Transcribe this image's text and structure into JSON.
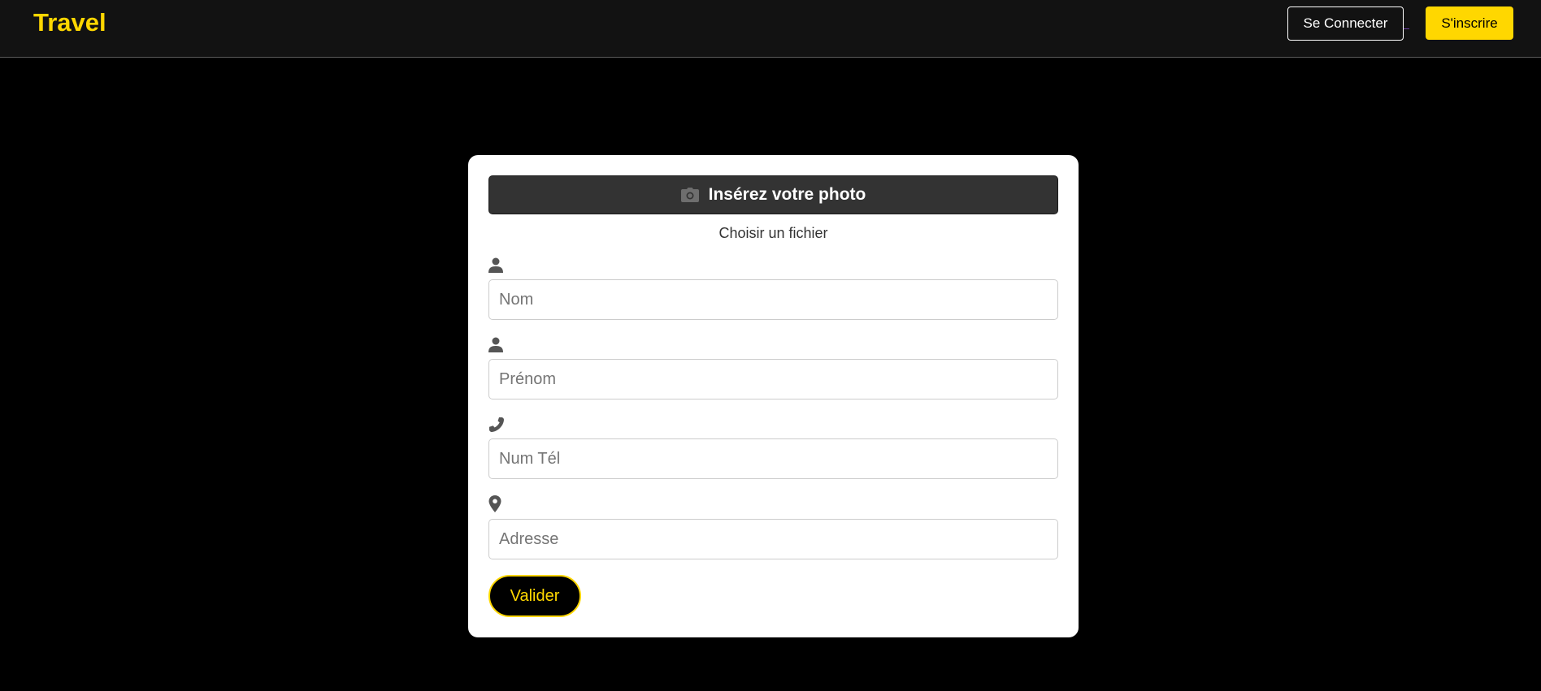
{
  "navbar": {
    "brand": "Travel",
    "login_label": "Se Connecter",
    "signup_label": "S'inscrire"
  },
  "form": {
    "photo_button_label": "Insérez votre photo",
    "file_text": "Choisir un fichier",
    "fields": [
      {
        "icon": "user-icon",
        "placeholder": "Nom",
        "value": ""
      },
      {
        "icon": "user-icon",
        "placeholder": "Prénom",
        "value": ""
      },
      {
        "icon": "phone-icon",
        "placeholder": "Num Tél",
        "value": ""
      },
      {
        "icon": "map-marker-icon",
        "placeholder": "Adresse",
        "value": ""
      }
    ],
    "submit_label": "Valider"
  },
  "colors": {
    "accent": "#ffd700",
    "navbar_bg": "#121212",
    "page_bg": "#000000",
    "card_bg": "#ffffff",
    "photo_button_bg": "#333333",
    "icon": "#555555"
  }
}
